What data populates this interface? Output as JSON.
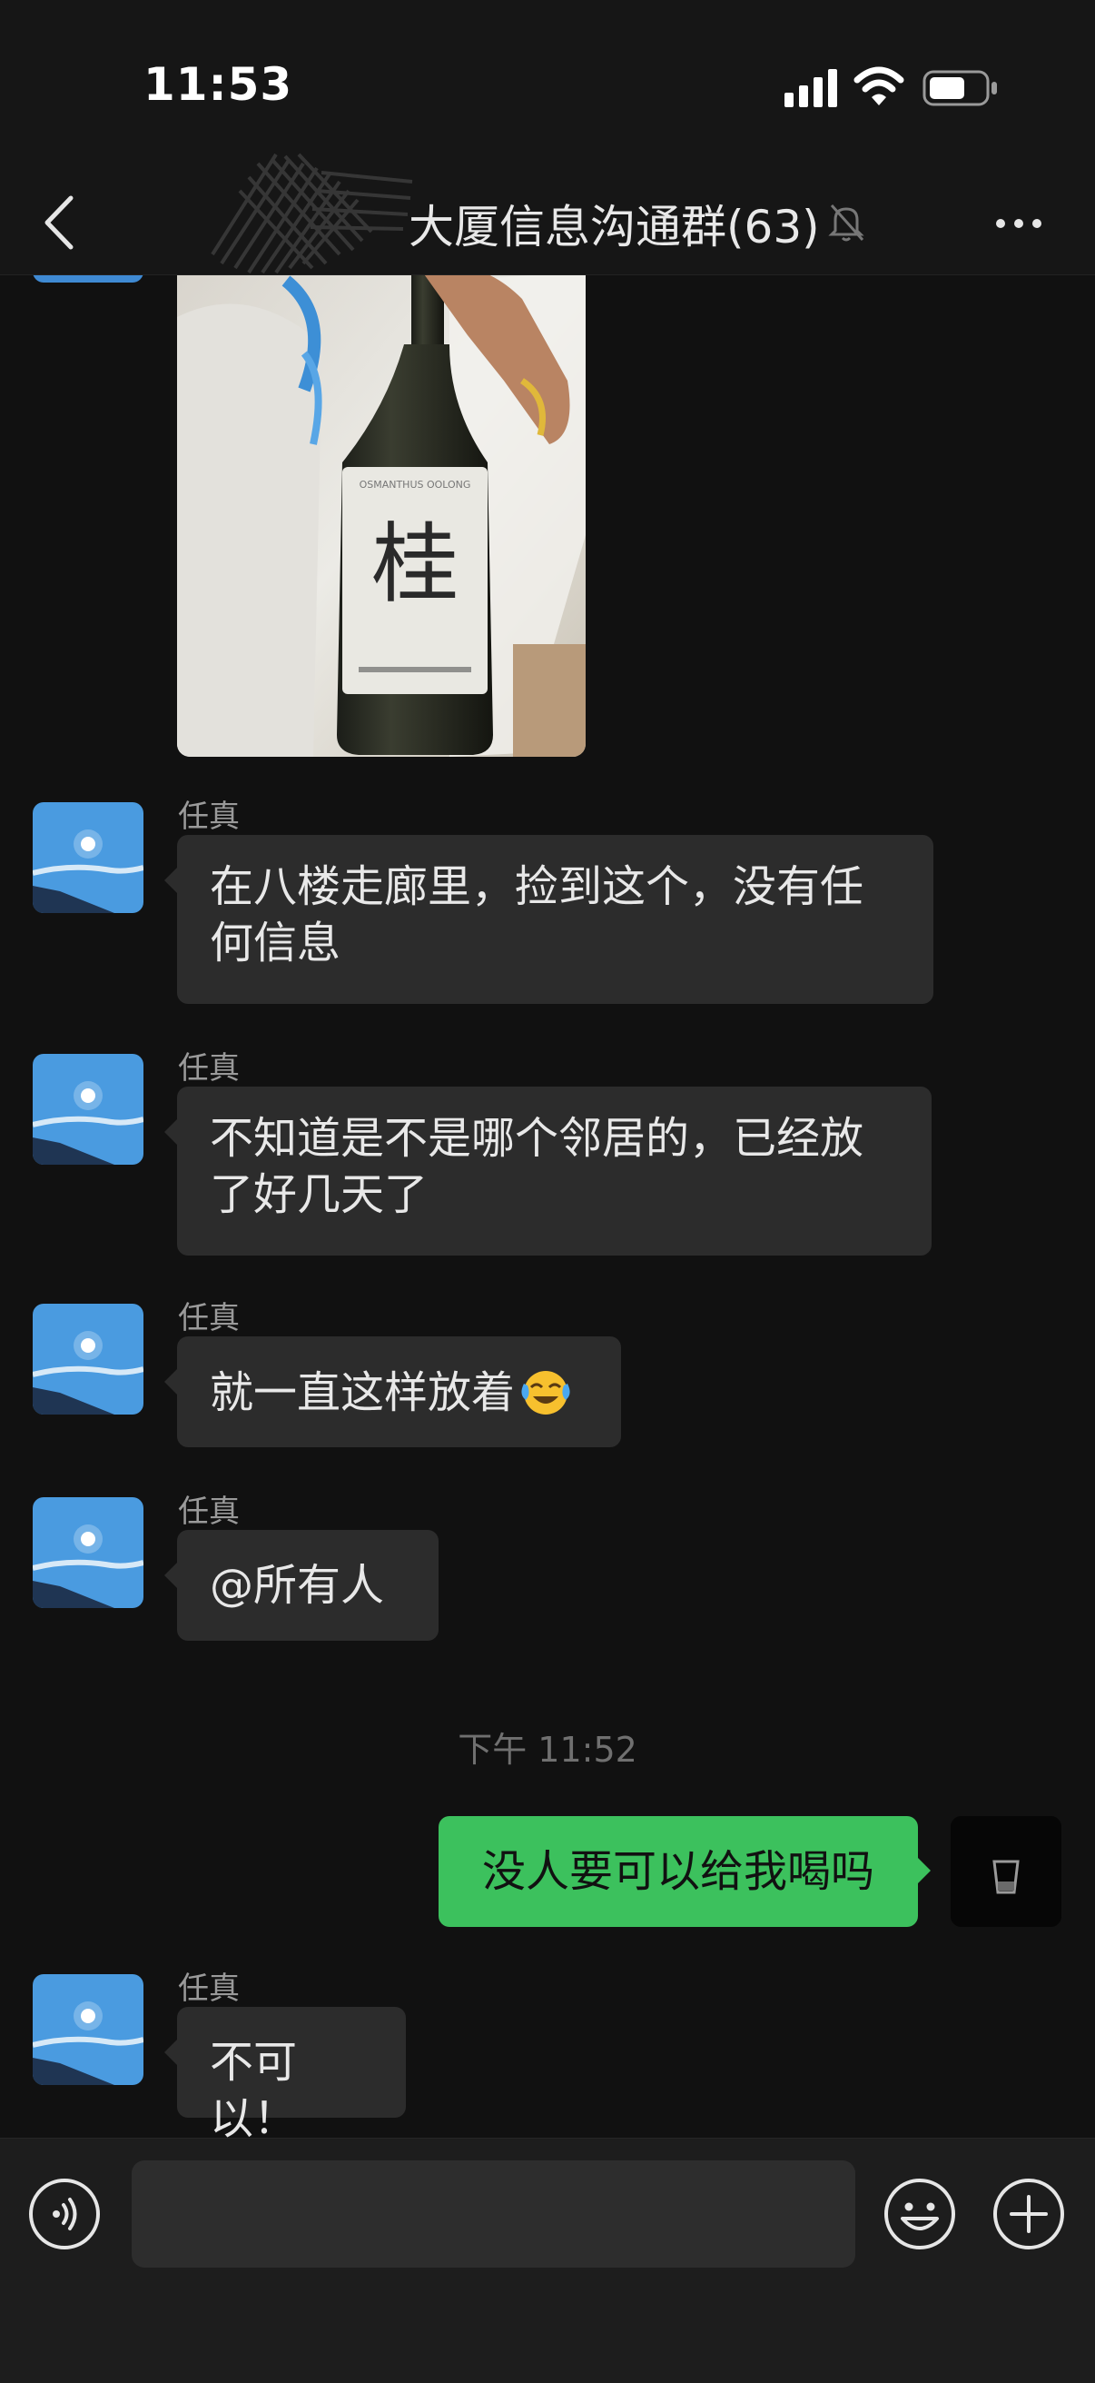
{
  "status_bar": {
    "time": "11:53"
  },
  "header": {
    "title": "大厦信息沟通群(63)"
  },
  "photo": {
    "label_text": "桂",
    "label_top_text": "OSMANTHUS OOLONG"
  },
  "messages": [
    {
      "sender": "任真",
      "text_lines": [
        "在八楼走廊里，捡到这个，没有任",
        "何信息"
      ]
    },
    {
      "sender": "任真",
      "text_lines": [
        "不知道是不是哪个邻居的，已经放",
        "了好几天了"
      ]
    },
    {
      "sender": "任真",
      "text": "就一直这样放着"
    },
    {
      "sender": "任真",
      "text": "@所有人"
    },
    {
      "sender": "任真",
      "text": "不可以！"
    }
  ],
  "timestamp": "下午 11:52",
  "my_message": {
    "text": "没人要可以给我喝吗"
  },
  "input": {
    "placeholder": ""
  },
  "colors": {
    "accent_green": "#3cc15d",
    "bubble_gray": "#2c2c2c",
    "background": "#111111"
  }
}
